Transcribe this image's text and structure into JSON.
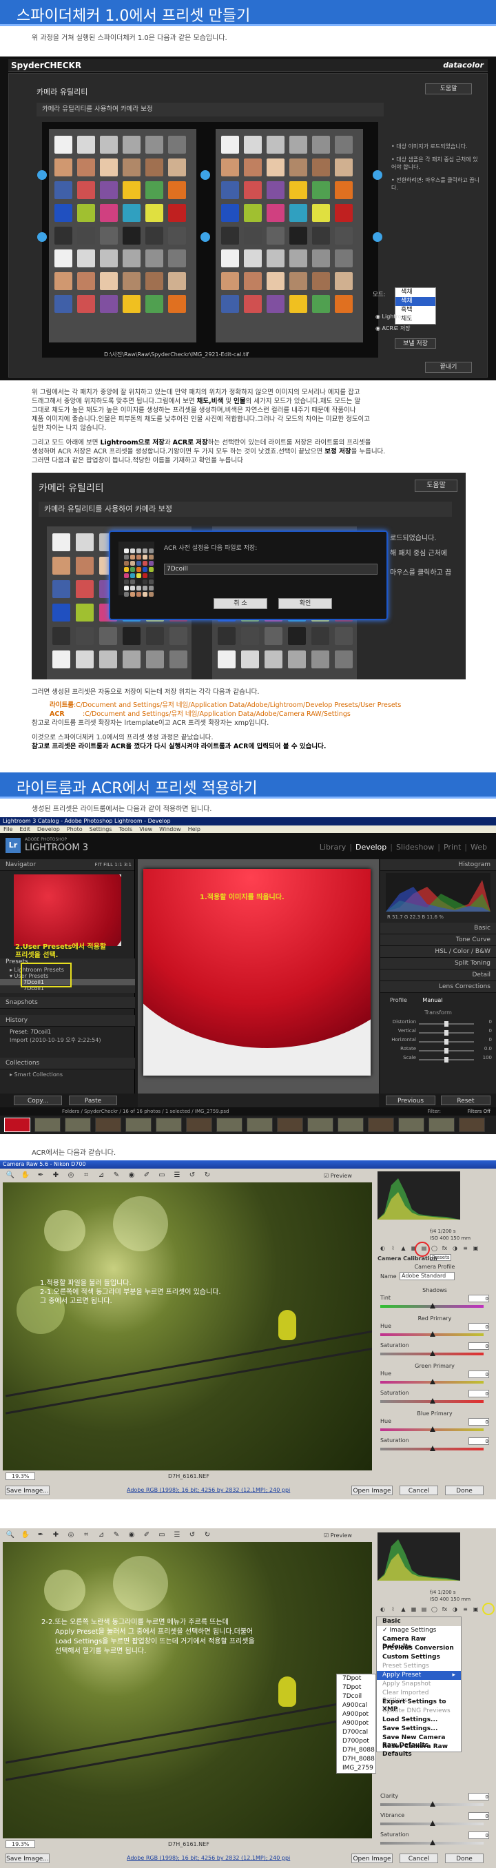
{
  "banner1": {
    "title": "스파이더체커 1.0에서 프리셋 만들기"
  },
  "banner1_caption": "위 과정을 거쳐 실행된 스파이더체커 1.0은 다음과 같은 모습입니다.",
  "spyder": {
    "brand": "SpyderCHECKR",
    "brand_right": "datacolor",
    "help_btn": "도움말",
    "title": "카메라 유틸리티",
    "subtitle": "카메라 유틸리티를 사용하여 카메라 보정",
    "notes": [
      "• 대상 이미지가 로드되었습니다.",
      "• 대상 샘플은 각 패치 중심 근처에 있어야 합니다.",
      "• 전환하려면: 마우스를 클릭하고 끕니다."
    ],
    "mode_label": "모드:",
    "mode_value": "색채",
    "mode_options": [
      "색채",
      "흑백",
      "채도"
    ],
    "radio_lightroom": "Lightroom",
    "radio_acr": "ACR로 저장",
    "save_btn": "보낼 저장",
    "path": "D:\\사진\\Raw\\Raw\\SpyderCheckr\\IMG_2921-Edit-cal.tif",
    "finish_btn": "끝내기"
  },
  "para1": {
    "lines": [
      "위 그림에서는 각 패치가 중앙에 잘 위치하고 있는데 만약 패치의 위치가 정확하지 않으면 이미지의 모서리나 에지를 잡고",
      "드래그해서 중앙에 위치하도록 맞추면 됩니다.그림에서 보면 ",
      "그대로 채도가 높은 채도가 높은 이미지를 생성하는 프리셋을 생성하며,비색은 자연스런 컬러를 내주기 때문에 작품이나",
      "제품 이미지에 좋습니다.인물은 피부톤의 채도를 낮추어진 인물 사진에 적합합니다.그러나 각 모드의 차이는 미묘한 정도이고",
      "실한 차이는 나지 않습니다."
    ],
    "bold1": "채도,비색",
    "mid1": " 및 ",
    "bold2": "인물",
    "tail1": "의 세가지 모드가 있습니다.채도 모드는 말"
  },
  "para2": {
    "l1a": "그리고 모드 아래에 보면 ",
    "l1b": "Lightroom으로 저장",
    "l1c": "과 ",
    "l1d": "ACR로 저장",
    "l1e": "하는 선택란이 있는데 라이트룸 저장은 라이트룸의 프리셋을",
    "l2a": "생성하며 ACR 저장은 ACR 프리셋을 생성합니다.기왕이면 두 가지 모두 하는 것이 낫겠죠.선택이 끝났으면 ",
    "l2b": "보정 저장",
    "l2c": "을 누릅니다.",
    "l3": "그러면 다음과 같은 팝업창이 뜹니다.적당한 이름을 기재하고 확인을 누릅니다"
  },
  "spyder2": {
    "title": "카메라 유틸리티",
    "subtitle": "카메라 유틸리티를 사용하여 카메라 보정",
    "help_btn": "도움말",
    "dialog_label": "ACR 사전 설정을 다음 파일로 저장:",
    "dialog_value": "7Dcoill",
    "cancel_btn": "취 소",
    "ok_btn": "확인",
    "side1": "로드되었습니다.",
    "side2": "해 패치 중심 근처에",
    "side3": "마우스를 클릭하고 끕"
  },
  "para3": {
    "intro": "그러면 생성된 프리셋은 자동으로 저장이 되는데 저장 위치는 각각 다음과 같습니다.",
    "lr_label": "라이트룸",
    "lr_path": ":C/Document and Settings/유저 네임/Application Data/Adobe/Lightroom/Develop Presets/User Presets",
    "acr_label": "ACR",
    "acr_path": ":C/Document and Settings/유저 네임/Application Data/Adobe/Camera RAW/Settings",
    "note": "참고로 라이트룸 프리셋 확장자는 lrtemplate이고 ACR 프리셋 확장자는 xmp입니다.",
    "end1": "이것으로 스파이더체커 1.0에서의 프리셋 생성 과정은 끝났습니다.",
    "end2": "참고로 프리셋은 라이트룸과 ACR을 껐다가 다시 실행시켜야 라이트룸과 ACR에 입력되어 볼 수 있습니다."
  },
  "banner2": {
    "title": "라이트룸과 ACR에서 프리셋 적용하기"
  },
  "banner2_caption": "생성된 프리셋은 라이트룸에서는 다음과 같이 적용하면 됩니다.",
  "lightroom": {
    "window_title": "Lightroom 3 Catalog - Adobe Photoshop Lightroom - Develop",
    "menus": [
      "File",
      "Edit",
      "Develop",
      "Photo",
      "Settings",
      "Tools",
      "View",
      "Window",
      "Help"
    ],
    "logo_small": "ADOBE PHOTOSHOP",
    "logo": "LIGHTROOM 3",
    "lr_badge": "Lr",
    "modules": [
      "Library",
      "Develop",
      "Slideshow",
      "Print",
      "Web"
    ],
    "navigator": "Navigator",
    "nav_zoom": "FIT   FILL   1:1   3:1",
    "presets_label": "Presets",
    "preset_groups": [
      "▸ Lightroom Presets",
      "▾ User Presets"
    ],
    "user_presets": [
      "7Dcoil1",
      "7Dcoil1"
    ],
    "annot_left_1": "2.User Presets에서 적용할",
    "annot_left_2": "프리셋을 선택.",
    "snapshots": "Snapshots",
    "history": "History",
    "history_items": [
      "Preset: 7Dcoil1",
      "Import (2010-10-19 오후 2:22:54)"
    ],
    "collections": "Collections",
    "smart_collections": "▸ Smart Collections",
    "copy_btn": "Copy...",
    "paste_btn": "Paste",
    "annot_main": "1.적용할 이미지를 띄웁니다.",
    "histogram": "Histogram",
    "hist_readout": "R  51.7   G  22.3   B  11.6  %",
    "right_panels": [
      "Basic",
      "Tone Curve",
      "HSL / Color / B&W",
      "Split Toning",
      "Detail",
      "Lens Corrections"
    ],
    "lens_tabs": [
      "Profile",
      "Manual"
    ],
    "transform": "Transform",
    "transform_rows": [
      "Distortion",
      "Vertical",
      "Horizontal",
      "Rotate",
      "Scale"
    ],
    "transform_vals": [
      "0",
      "0",
      "0",
      "0.0",
      "100"
    ],
    "previous_btn": "Previous",
    "reset_btn": "Reset",
    "filmstrip_path": "Folders / SpyderCheckr / 16 of 16 photos / 1 selected / IMG_2759.psd",
    "filter_label": "Filter:",
    "filter_value": "Filters Off"
  },
  "acr_caption": "ACR에서는 다음과 같습니다.",
  "acr1": {
    "title": "Camera Raw 5.6  -  Nikon D700",
    "preview": "Preview",
    "exif": [
      "f/4   1/200 s",
      "ISO 400   150 mm"
    ],
    "tab_label": "Presets",
    "panel_title": "Camera Calibration",
    "camera_profile": "Camera Profile",
    "profile_label": "Name",
    "profile_value": "Adobe Standard",
    "sections": [
      "Shadows",
      "Red Primary",
      "Green Primary",
      "Blue Primary"
    ],
    "tint": "Tint",
    "hue": "Hue",
    "saturation": "Saturation",
    "annot": [
      "1.적용할 파일을 불러 들입니다.",
      "2-1.오른쪽에 적색 동그라미 부분을 누르면 프리셋이 있습니다.",
      "그 중에서 고르면 됩니다."
    ],
    "zoom": "19.3%",
    "filename": "D7H_6161.NEF",
    "save_btn": "Save Image...",
    "workflow": "Adobe RGB (1998); 16 bit; 4256 by 2832 (12.1MP); 240 ppi",
    "open_btn": "Open Image",
    "cancel_btn": "Cancel",
    "done_btn": "Done",
    "values": [
      "0",
      "0",
      "0",
      "0",
      "0",
      "0",
      "0"
    ]
  },
  "acr2": {
    "title": "",
    "preview": "Preview",
    "exif": [
      "f/4   1/200 s",
      "ISO 400   150 mm"
    ],
    "annot": [
      "2-2.또는 오른쪽 노란색 동그라미를 누르면 메뉴가 주르륵 뜨는데",
      "Apply Preset을 눌러서 그 중에서 프리셋을 선택하면 됩니다.더불어",
      "Load Settings을 누르면 팝업창이 뜨는데 거기에서 적용할 프리셋을",
      "선택해서 열기를 누르면 됩니다."
    ],
    "menu_header": "Basic",
    "menu_items": [
      "✓ Image Settings",
      "Camera Raw Defaults",
      "Previous Conversion",
      "Custom Settings",
      "Preset Settings"
    ],
    "apply_preset": "Apply Preset",
    "menu_items2": [
      "Apply Snapshot",
      "Clear Imported Settings",
      "Export Settings to XMP",
      "Update DNG Previews",
      "Load Settings...",
      "Save Settings...",
      "Save New Camera Raw Defaults",
      "Reset Camera Raw Defaults"
    ],
    "submenu": [
      "7Dpot",
      "7Dpot",
      "7Dcoil",
      "A900cal",
      "A900pot",
      "A900pot",
      "D700cal",
      "D700pot",
      "D7H_8088",
      "D7H_8088",
      "IMG_2759"
    ],
    "bottom_labels": [
      "Clarity",
      "Vibrance",
      "Saturation"
    ],
    "bottom_values": [
      "0",
      "0",
      "0"
    ],
    "zoom": "19.3%",
    "filename": "D7H_6161.NEF",
    "save_btn": "Save Image...",
    "workflow": "Adobe RGB (1998); 16 bit; 4256 by 2832 (12.1MP); 240 ppi",
    "open_btn": "Open Image",
    "cancel_btn": "Cancel",
    "done_btn": "Done"
  },
  "colors": {
    "banner": "#2a6fd0",
    "accent_red": "#e8262a",
    "lr_yellow": "#e8e020",
    "link_orange": "#d86a00"
  }
}
